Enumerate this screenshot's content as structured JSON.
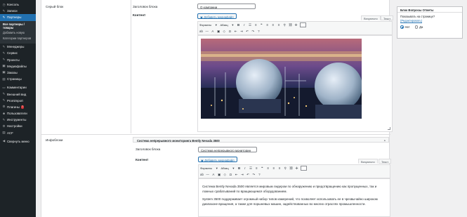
{
  "sidebar": {
    "items": [
      {
        "label": "Консоль",
        "icon": "dashboard-icon",
        "glyph": "◷"
      },
      {
        "label": "Записи",
        "icon": "pin-icon",
        "glyph": "✎"
      },
      {
        "label": "Партнеры",
        "icon": "partners-icon",
        "glyph": "✎",
        "active": true
      }
    ],
    "submenu": [
      "Все партнеры / товары",
      "Добавить новую",
      "Категории партнеров"
    ],
    "items2": [
      {
        "label": "Менеджеры",
        "icon": "managers-icon",
        "glyph": "✎"
      },
      {
        "label": "Сервис",
        "icon": "service-icon",
        "glyph": "✎"
      },
      {
        "label": "Проекты",
        "icon": "projects-icon",
        "glyph": "✎"
      },
      {
        "label": "Медиафайлы",
        "icon": "media-icon",
        "glyph": "▣"
      },
      {
        "label": "Заказы",
        "icon": "orders-icon",
        "glyph": "▣"
      },
      {
        "label": "Страницы",
        "icon": "pages-icon",
        "glyph": "▤"
      },
      {
        "label": "Комментарии",
        "icon": "comments-icon",
        "glyph": "▭"
      },
      {
        "label": "Внешний вид",
        "icon": "appearance-icon",
        "glyph": "✎"
      },
      {
        "label": "Promimport",
        "icon": "import-icon",
        "glyph": "✎"
      },
      {
        "label": "Плагины",
        "icon": "plugins-icon",
        "glyph": "⚙",
        "badge": "7"
      },
      {
        "label": "Пользователи",
        "icon": "users-icon",
        "glyph": "☻"
      },
      {
        "label": "Инструменты",
        "icon": "tools-icon",
        "glyph": "✎"
      },
      {
        "label": "Настройки",
        "icon": "settings-icon",
        "glyph": "⚙"
      },
      {
        "label": "ACF",
        "icon": "acf-icon",
        "glyph": "▤"
      },
      {
        "label": "Свернуть меню",
        "icon": "collapse-icon",
        "glyph": "◀"
      }
    ]
  },
  "gray_block": {
    "section_label": "Серый блок",
    "title_label": "Заголовок блока",
    "title_value": "О компании",
    "content_label": "Контент",
    "media_button": "Добавить медиафайл",
    "tab_visual": "Визуально",
    "tab_text": "Текст",
    "format_select": "Форматы",
    "paragraph_select": "Абзац",
    "image_alt": "industrial plant with gas storage spheres at night"
  },
  "infoblocks": {
    "section_label": "Инфоблоки",
    "group_title": "Система непрерывного мониторинга Bently Nevada 3500",
    "title_label": "Заголовок блока",
    "title_value": "Система непрерывного мониторин",
    "content_label": "Контент",
    "media_button": "Добавить медиафайл",
    "tab_visual": "Визуально",
    "tab_text": "Текст",
    "format_select": "Форматы",
    "paragraph_select": "Абзац",
    "paragraphs": [
      "Система Bently Nevada 3500 является мировым лидером по обнаружению и предотвращению как пропущенных, так и ложных срабатываний по вращающемся оборудованием.",
      "System 3500 поддерживает огромный набор типов измерений, что позволяет использовать ее в чрезвычайно широком диапазоне вращения, а также для поршневых машин, задействованных во многих отраслях промышленности."
    ]
  },
  "side_panel": {
    "title": "Блок Вопросы Ответы",
    "question": "Показывать на странице?",
    "link": "(Редактировать)",
    "options": [
      "Нет",
      "Да"
    ],
    "selected": "Нет"
  },
  "colors": {
    "sidebar_bg": "#1d2327",
    "active_bg": "#2271b1",
    "accent": "#2271b1"
  }
}
